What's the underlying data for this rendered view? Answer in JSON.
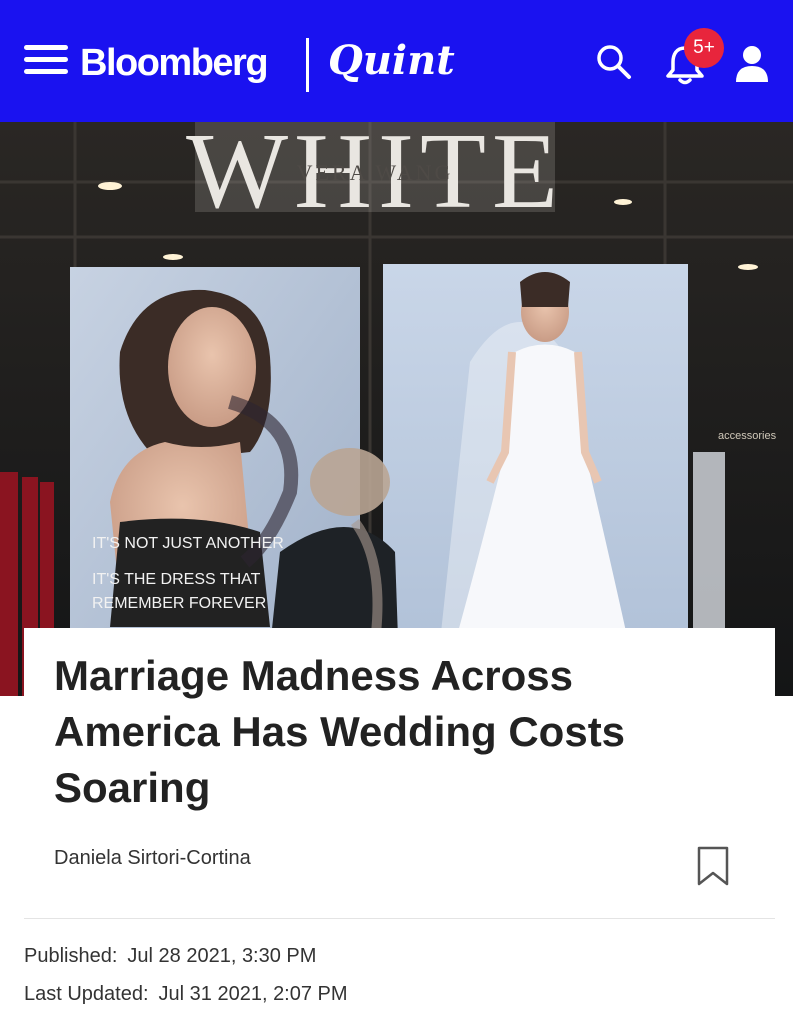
{
  "header": {
    "brand_primary": "Bloomberg",
    "brand_secondary": "Quint",
    "notification_badge": "5+",
    "background_color": "#1a12f0",
    "icons": [
      "menu-icon",
      "search-icon",
      "bell-icon",
      "user-icon"
    ]
  },
  "hero_image": {
    "sign_text": "WHITE",
    "sign_subtext": "VERA WANG",
    "poster_lines": [
      "IT'S NOT JUST ANOTHER",
      "IT'S THE DRESS THAT",
      "REMEMBER FOREVER"
    ],
    "store_sign": "accessories"
  },
  "article": {
    "headline": "Marriage Madness Across America Has Wedding Costs Soaring",
    "author": "Daniela Sirtori-Cortina",
    "published_label": "Published:",
    "published_value": "Jul 28 2021, 3:30 PM",
    "updated_label": "Last Updated:",
    "updated_value": "Jul 31 2021, 2:07 PM"
  }
}
